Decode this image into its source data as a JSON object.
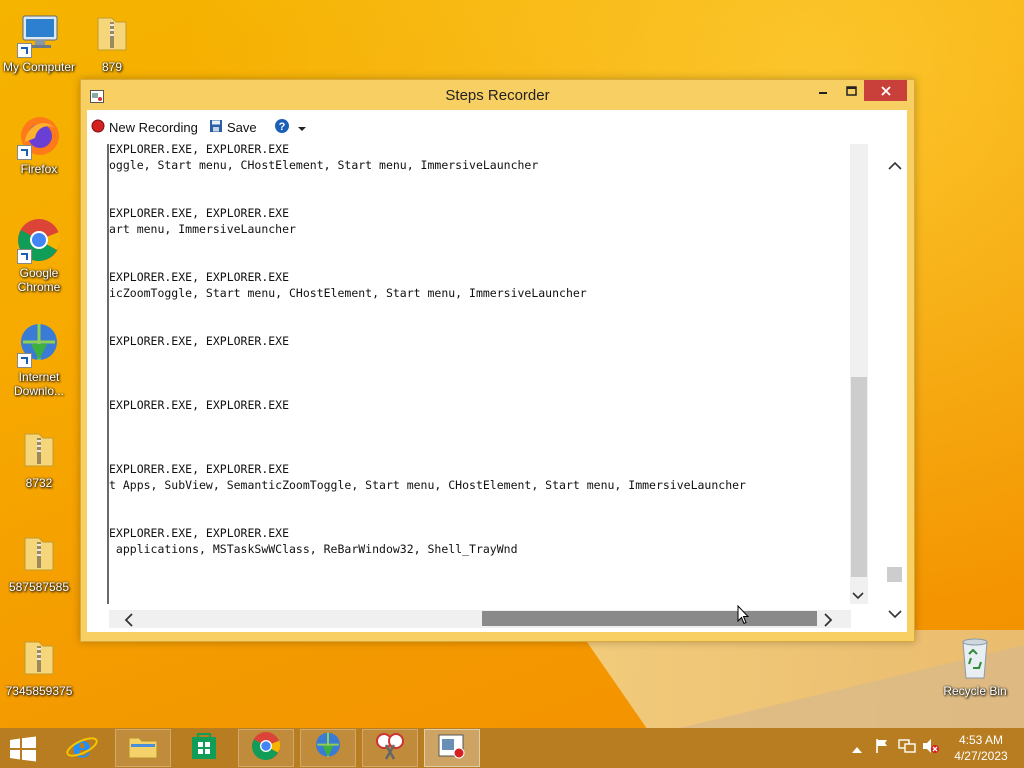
{
  "desktop": {
    "icons": [
      {
        "label": "My Computer"
      },
      {
        "label": "879"
      },
      {
        "label": "Firefox"
      },
      {
        "label": "Google Chrome"
      },
      {
        "label": "Internet Downlo..."
      },
      {
        "label": "8732"
      },
      {
        "label": "587587585"
      },
      {
        "label": "7345859375"
      },
      {
        "label": "Recycle Bin"
      }
    ]
  },
  "window": {
    "title": "Steps Recorder",
    "toolbar": {
      "new_recording": "New Recording",
      "save": "Save"
    },
    "log_lines": [
      "EXPLORER.EXE, EXPLORER.EXE",
      "oggle, Start menu, CHostElement, Start menu, ImmersiveLauncher",
      "EXPLORER.EXE, EXPLORER.EXE",
      "art menu, ImmersiveLauncher",
      "EXPLORER.EXE, EXPLORER.EXE",
      "icZoomToggle, Start menu, CHostElement, Start menu, ImmersiveLauncher",
      "EXPLORER.EXE, EXPLORER.EXE",
      "EXPLORER.EXE, EXPLORER.EXE",
      "EXPLORER.EXE, EXPLORER.EXE",
      "t Apps, SubView, SemanticZoomToggle, Start menu, CHostElement, Start menu, ImmersiveLauncher",
      "EXPLORER.EXE, EXPLORER.EXE",
      " applications, MSTaskSwWClass, ReBarWindow32, Shell_TrayWnd"
    ]
  },
  "taskbar": {
    "apps": [
      "Internet Explorer",
      "File Explorer",
      "Store",
      "Google Chrome",
      "Internet Download Manager",
      "Snipping Tool",
      "Steps Recorder"
    ],
    "clock": {
      "time": "4:53 AM",
      "date": "4/27/2023"
    }
  }
}
